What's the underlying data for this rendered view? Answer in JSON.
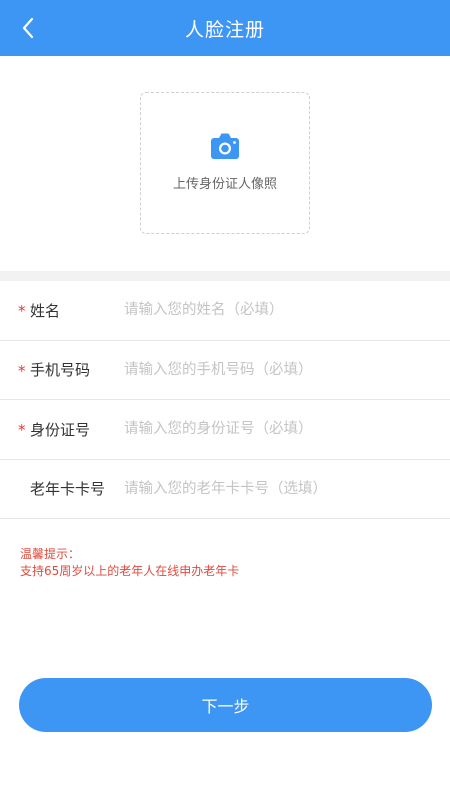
{
  "header": {
    "title": "人脸注册",
    "back_icon": "chevron-left-icon",
    "background": "#3d95f4"
  },
  "upload": {
    "icon": "camera-icon",
    "label": "上传身份证人像照"
  },
  "form": {
    "fields": [
      {
        "label": "姓名",
        "required": true,
        "placeholder": "请输入您的姓名（必填）",
        "value": ""
      },
      {
        "label": "手机号码",
        "required": true,
        "placeholder": "请输入您的手机号码（必填）",
        "value": ""
      },
      {
        "label": "身份证号",
        "required": true,
        "placeholder": "请输入您的身份证号（必填）",
        "value": ""
      },
      {
        "label": "老年卡卡号",
        "required": false,
        "placeholder": "请输入您的老年卡卡号（选填）",
        "value": ""
      }
    ],
    "required_mark": "*"
  },
  "tips": {
    "title": "温馨提示：",
    "text": "支持65周岁以上的老年人在线申办老年卡"
  },
  "actions": {
    "next_label": "下一步"
  }
}
